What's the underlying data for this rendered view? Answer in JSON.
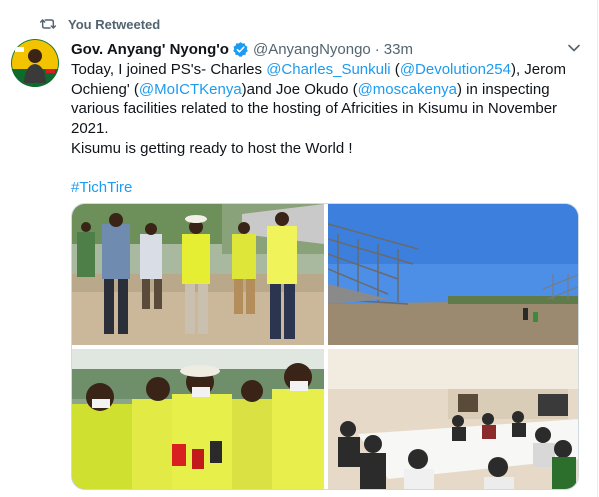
{
  "retweet": {
    "icon": "retweet-icon",
    "label": "You Retweeted"
  },
  "author": {
    "name": "Gov. Anyang' Nyong'o",
    "verified_icon": "verified-badge-icon",
    "handle": "@AnyangNyongo",
    "separator": "·",
    "time": "33m",
    "avatar_icon": "avatar"
  },
  "menu_icon": "chevron-down-icon",
  "text": {
    "l1_a": "Today, I joined PS's- Charles ",
    "l1_m1": "@Charles_Sunkuli",
    "l1_b": " (",
    "l1_m2": "@Devolution254",
    "l1_c": "), Jerom",
    "l2_a": "Ochieng' (",
    "l2_m1": "@MoICTKenya",
    "l2_b": ")and Joe Okudo (",
    "l2_m2": "@moscakenya",
    "l2_c": ") in inspecting",
    "l3": "various facilities related to the hosting of Africities in Kisumu in November",
    "l4": "2021.",
    "l5": "Kisumu is getting ready to host the World !",
    "hashtag": "#TichTire"
  },
  "colors": {
    "link": "#1d9bf0",
    "secondary_text": "#536471",
    "verified": "#1d9bf0"
  },
  "photos": {
    "count": 4,
    "photo_labels": [
      "site-inspection-walk",
      "stadium-construction",
      "press-interview",
      "conference-meeting"
    ]
  }
}
